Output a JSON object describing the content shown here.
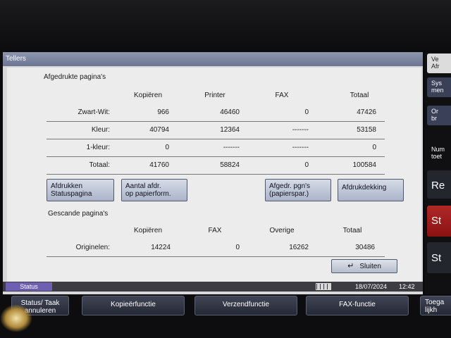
{
  "window": {
    "title": "Tellers"
  },
  "printed": {
    "section_title": "Afgedrukte pagina's",
    "columns": [
      "Kopiëren",
      "Printer",
      "FAX",
      "Totaal"
    ],
    "rows": [
      {
        "label": "Zwart-Wit:",
        "values": [
          "966",
          "46460",
          "0",
          "47426"
        ]
      },
      {
        "label": "Kleur:",
        "values": [
          "40794",
          "12364",
          "-------",
          "53158"
        ]
      },
      {
        "label": "1-kleur:",
        "values": [
          "0",
          "-------",
          "-------",
          "0"
        ]
      },
      {
        "label": "Totaal:",
        "values": [
          "41760",
          "58824",
          "0",
          "100584"
        ]
      }
    ]
  },
  "buttons": {
    "status_page": [
      "Afdrukken",
      "Statuspagina"
    ],
    "per_paper": [
      "Aantal afdr.",
      "op papierform."
    ],
    "paper_saving": [
      "Afgedr. pgn's",
      "(papierspar.)"
    ],
    "coverage": "Afdrukdekking",
    "close": "Sluiten"
  },
  "scanned": {
    "section_title": "Gescande pagina's",
    "columns": [
      "Kopiëren",
      "FAX",
      "Overige",
      "Totaal"
    ],
    "row": {
      "label": "Originelen:",
      "values": [
        "14224",
        "0",
        "16262",
        "30486"
      ]
    }
  },
  "statusbar": {
    "status_tab": "Status",
    "date": "18/07/2024",
    "time": "12:42"
  },
  "side_buttons": {
    "b1": [
      "Ve",
      "Afr"
    ],
    "b2": [
      "Sys",
      "men"
    ],
    "b3": [
      "Or",
      "br"
    ],
    "b4": [
      "Num",
      "toet"
    ],
    "b5": "Re",
    "b6": "St",
    "b7": "St"
  },
  "bottom_buttons": {
    "status_job": [
      "Status/ Taak",
      "annuleren"
    ],
    "copy": "Kopieërfunctie",
    "send": "Verzendfunctie",
    "fax": "FAX-functie",
    "access": [
      "Toega",
      "lijkh"
    ]
  },
  "colors": {
    "titlebar": "#7a84a0",
    "stop": "#a01e1e",
    "status_tab": "#6e5fb2"
  }
}
